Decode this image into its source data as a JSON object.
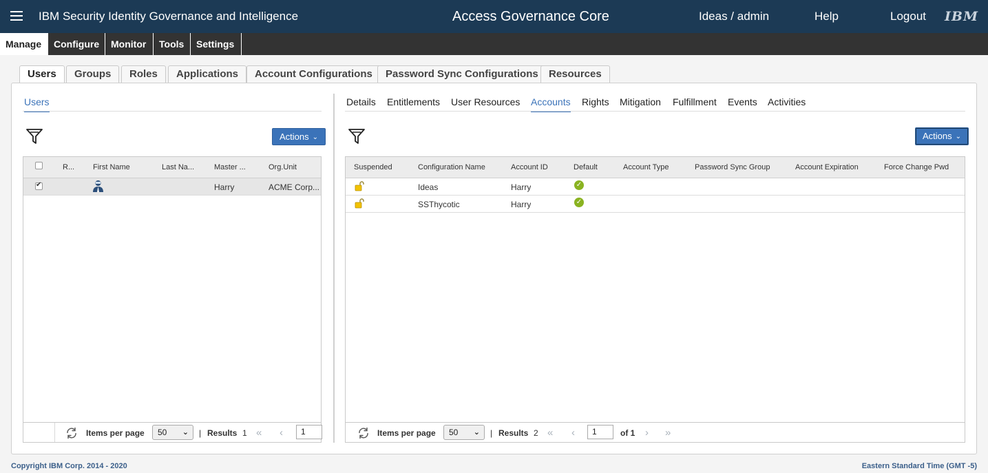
{
  "header": {
    "product_name": "IBM Security Identity Governance and Intelligence",
    "app_title": "Access Governance Core",
    "user": "Ideas / admin",
    "help": "Help",
    "logout": "Logout",
    "logo": "IBM"
  },
  "menu": [
    "Manage",
    "Configure",
    "Monitor",
    "Tools",
    "Settings"
  ],
  "tabs": [
    "Users",
    "Groups",
    "Roles",
    "Applications",
    "Account Configurations",
    "Password Sync Configurations",
    "Resources"
  ],
  "left": {
    "subtab": "Users",
    "actions_label": "Actions",
    "columns": [
      "R...",
      "First Name",
      "Last Na...",
      "Master ...",
      "Org.Unit"
    ],
    "rows": [
      {
        "first_name": "",
        "last_name": "",
        "master": "Harry",
        "org_unit": "ACME Corp..."
      }
    ],
    "footer": {
      "items_per_page_label": "Items per page",
      "items_per_page": "50",
      "sep": "|",
      "results_label": "Results",
      "results": "1",
      "page": "1"
    }
  },
  "right": {
    "subtabs": [
      "Details",
      "Entitlements",
      "User Resources",
      "Accounts",
      "Rights",
      "Mitigation",
      "Fulfillment",
      "Events",
      "Activities"
    ],
    "active_subtab": "Accounts",
    "actions_label": "Actions",
    "columns": [
      "Suspended",
      "Configuration Name",
      "Account ID",
      "Default",
      "Account Type",
      "Password Sync Group",
      "Account Expiration",
      "Force Change Pwd"
    ],
    "rows": [
      {
        "config_name": "Ideas",
        "account_id": "Harry"
      },
      {
        "config_name": "SSThycotic",
        "account_id": "Harry"
      }
    ],
    "footer": {
      "items_per_page_label": "Items per page",
      "items_per_page": "50",
      "sep": "|",
      "results_label": "Results",
      "results": "2",
      "page": "1",
      "of_label": "of 1"
    }
  },
  "footer": {
    "copyright": "Copyright IBM Corp. 2014 - 2020",
    "timezone": "Eastern Standard Time (GMT -5)"
  },
  "colors": {
    "header_bg": "#1c3a55",
    "menubar_bg": "#333333",
    "accent": "#3b73b9",
    "ok": "#8ab321"
  }
}
